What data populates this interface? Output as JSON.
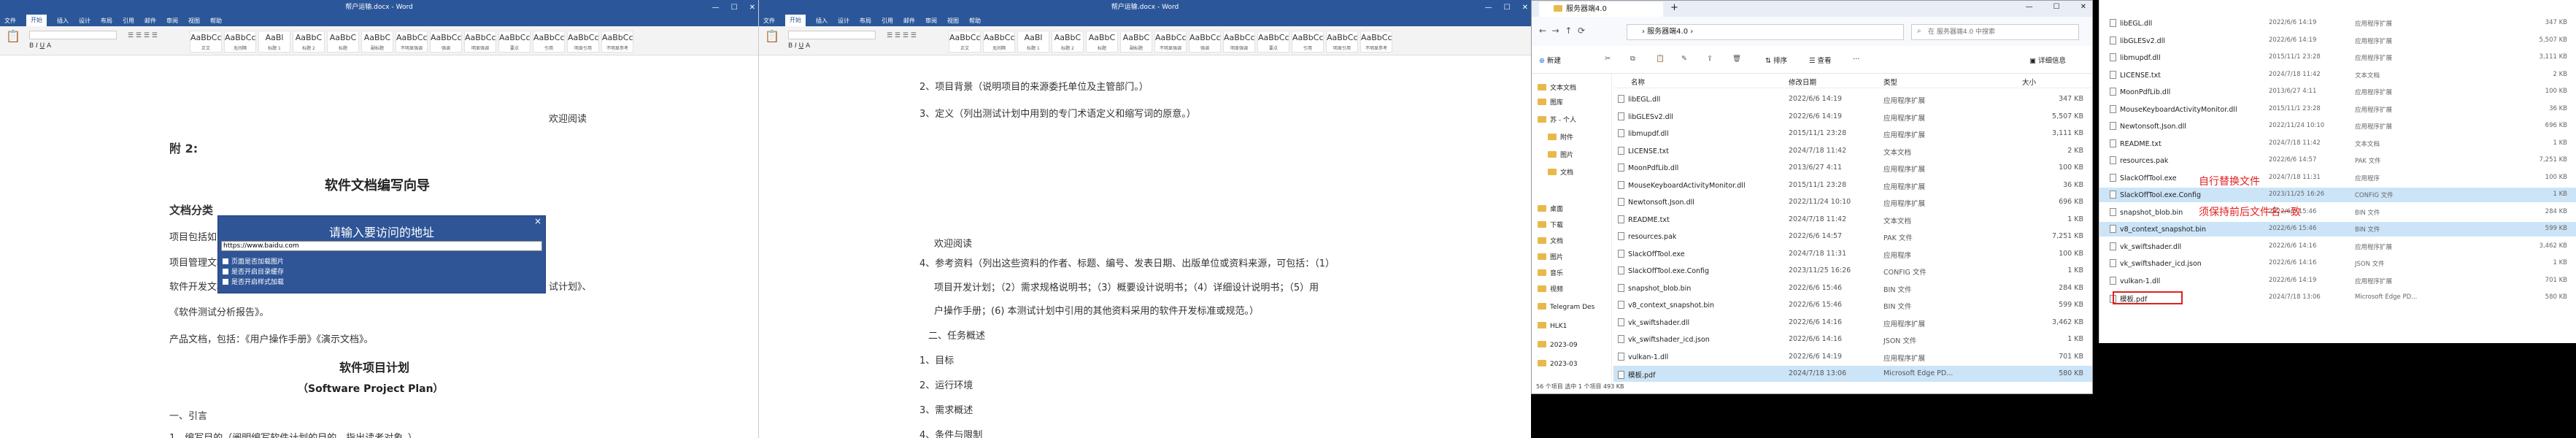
{
  "word_window_1": {
    "title": "帮户运输.docx - Word",
    "tabs": [
      "文件",
      "开始",
      "插入",
      "设计",
      "布局",
      "引用",
      "邮件",
      "审阅",
      "视图",
      "帮助"
    ],
    "active_tab": "开始",
    "styles": [
      {
        "sample": "AaBbCcDd",
        "name": "正文"
      },
      {
        "sample": "AaBbCcDd",
        "name": "无间隔"
      },
      {
        "sample": "AaBl",
        "name": "标题 1"
      },
      {
        "sample": "AaBbC",
        "name": "标题 2"
      },
      {
        "sample": "AaBbC",
        "name": "标题"
      },
      {
        "sample": "AaBbC",
        "name": "副标题"
      },
      {
        "sample": "AaBbCcDd",
        "name": "不明显强调"
      },
      {
        "sample": "AaBbCcDd",
        "name": "强调"
      },
      {
        "sample": "AaBbCcDd",
        "name": "明显强调"
      },
      {
        "sample": "AaBbCcDd",
        "name": "要点"
      },
      {
        "sample": "AaBbCcDd",
        "name": "引用"
      },
      {
        "sample": "AaBbCcDd",
        "name": "明显引用"
      },
      {
        "sample": "AaBbCcDd",
        "name": "不明显参考"
      }
    ],
    "doc": {
      "welcome": "欢迎阅读",
      "appendix": "附 2:",
      "heading1": "软件文档编写向导",
      "section": "文档分类",
      "p1": "项目包括如下几类文档：",
      "p2": "项目管理文档，包括：《软件需求说明书》、《数据库设计》",
      "p3": "软件开发文档，包括：《可行性分析报告》、《项目开发计划》、《软件需求规格说明书》、《测试计划》、",
      "p3b": "试计划》、",
      "p4": "《软件测试分析报告》。",
      "p5": "产品文档，包括：《用户操作手册》《演示文档》。",
      "heading2": "软件项目计划",
      "heading2_en": "（Software Project Plan）",
      "intro": "一、引言",
      "item1": "1、编写目的（阐明编写软件计划的目的，指出读者对象。）"
    },
    "popup": {
      "title": "请输入要访问的地址",
      "url": "https://www.baidu.com",
      "options": [
        "页面是否加载图片",
        "是否开启目录缓存",
        "是否开启样式加载"
      ],
      "close": "×"
    }
  },
  "word_window_2": {
    "title": "帮户运输.docx - Word",
    "tabs": [
      "文件",
      "开始",
      "插入",
      "设计",
      "布局",
      "引用",
      "邮件",
      "审阅",
      "视图",
      "帮助"
    ],
    "active_tab": "开始",
    "styles": [
      {
        "sample": "AaBbCcDd",
        "name": "正文"
      },
      {
        "sample": "AaBbCcDd",
        "name": "无间隔"
      },
      {
        "sample": "AaBl",
        "name": "标题 1"
      },
      {
        "sample": "AaBbC",
        "name": "标题 2"
      },
      {
        "sample": "AaBbC",
        "name": "标题"
      },
      {
        "sample": "AaBbC",
        "name": "副标题"
      },
      {
        "sample": "AaBbCcDd",
        "name": "不明显强调"
      },
      {
        "sample": "AaBbCcDd",
        "name": "强调"
      },
      {
        "sample": "AaBbCcDd",
        "name": "明显强调"
      },
      {
        "sample": "AaBbCcDd",
        "name": "要点"
      },
      {
        "sample": "AaBbCcDd",
        "name": "引用"
      },
      {
        "sample": "AaBbCcDd",
        "name": "明显引用"
      },
      {
        "sample": "AaBbCcDd",
        "name": "不明显参考"
      }
    ],
    "doc": {
      "l1": "2、项目背景（说明项目的来源委托单位及主管部门。）",
      "l2": "3、定义（列出测试计划中用到的专门术语定义和缩写词的原意。）",
      "welcome": "欢迎阅读",
      "l3": "4、参考资料（列出这些资料的作者、标题、编号、发表日期、出版单位或资料来源，可包括：（1）",
      "l4": "项目开发计划；（2）需求规格说明书；（3）概要设计说明书；（4）详细设计说明书；（5）用",
      "l5": "户操作手册；(6) 本测试计划中引用的其他资料采用的软件开发标准或规范。）",
      "l6": "二、任务概述",
      "l7": "1、目标",
      "l8": "2、运行环境",
      "l9": "3、需求概述",
      "l10": "4、条件与限制"
    }
  },
  "explorer": {
    "title": "服务器端4.0",
    "tab": "服务器端4.0",
    "plus": "+",
    "breadcrumb": [
      "服务器端4.0"
    ],
    "search_placeholder": "在 服务器端4.0 中搜索",
    "toolbar": {
      "new": "新建",
      "sort": "排序",
      "view": "查看",
      "details": "详细信息"
    },
    "columns": {
      "name": "名称",
      "date": "修改日期",
      "type": "类型",
      "size": "大小"
    },
    "nav": [
      {
        "label": "文本文档",
        "indent": 0
      },
      {
        "label": "图库",
        "indent": 0
      },
      {
        "label": "苏 - 个人",
        "indent": 0
      },
      {
        "label": "附件",
        "indent": 1
      },
      {
        "label": "图片",
        "indent": 1
      },
      {
        "label": "文档",
        "indent": 1
      },
      {
        "label": "桌面",
        "indent": 0
      },
      {
        "label": "下载",
        "indent": 0
      },
      {
        "label": "文档",
        "indent": 0
      },
      {
        "label": "图片",
        "indent": 0
      },
      {
        "label": "音乐",
        "indent": 0
      },
      {
        "label": "视频",
        "indent": 0
      },
      {
        "label": "Telegram Des",
        "indent": 0
      },
      {
        "label": "HLK1",
        "indent": 0
      },
      {
        "label": "2023-09",
        "indent": 0
      },
      {
        "label": "2023-03",
        "indent": 0
      }
    ],
    "files": [
      {
        "name": "libEGL.dll",
        "date": "2022/6/6 14:19",
        "type": "应用程序扩展",
        "size": "347 KB"
      },
      {
        "name": "libGLESv2.dll",
        "date": "2022/6/6 14:19",
        "type": "应用程序扩展",
        "size": "5,507 KB"
      },
      {
        "name": "libmupdf.dll",
        "date": "2015/11/1 23:28",
        "type": "应用程序扩展",
        "size": "3,111 KB"
      },
      {
        "name": "LICENSE.txt",
        "date": "2024/7/18 11:42",
        "type": "文本文档",
        "size": "2 KB"
      },
      {
        "name": "MoonPdfLib.dll",
        "date": "2013/6/27 4:11",
        "type": "应用程序扩展",
        "size": "100 KB"
      },
      {
        "name": "MouseKeyboardActivityMonitor.dll",
        "date": "2015/11/1 23:28",
        "type": "应用程序扩展",
        "size": "36 KB"
      },
      {
        "name": "Newtonsoft.Json.dll",
        "date": "2022/11/24 10:10",
        "type": "应用程序扩展",
        "size": "696 KB"
      },
      {
        "name": "README.txt",
        "date": "2024/7/18 11:42",
        "type": "文本文档",
        "size": "1 KB"
      },
      {
        "name": "resources.pak",
        "date": "2022/6/6 14:57",
        "type": "PAK 文件",
        "size": "7,251 KB"
      },
      {
        "name": "SlackOffTool.exe",
        "date": "2024/7/18 11:31",
        "type": "应用程序",
        "size": "100 KB"
      },
      {
        "name": "SlackOffTool.exe.Config",
        "date": "2023/11/25 16:26",
        "type": "CONFIG 文件",
        "size": "1 KB"
      },
      {
        "name": "snapshot_blob.bin",
        "date": "2022/6/6 15:46",
        "type": "BIN 文件",
        "size": "284 KB"
      },
      {
        "name": "v8_context_snapshot.bin",
        "date": "2022/6/6 15:46",
        "type": "BIN 文件",
        "size": "599 KB"
      },
      {
        "name": "vk_swiftshader.dll",
        "date": "2022/6/6 14:16",
        "type": "应用程序扩展",
        "size": "3,462 KB"
      },
      {
        "name": "vk_swiftshader_icd.json",
        "date": "2022/6/6 14:16",
        "type": "JSON 文件",
        "size": "1 KB"
      },
      {
        "name": "vulkan-1.dll",
        "date": "2022/6/6 14:19",
        "type": "应用程序扩展",
        "size": "701 KB"
      },
      {
        "name": "模板.pdf",
        "date": "2024/7/18 13:06",
        "type": "Microsoft Edge PD...",
        "size": "580 KB"
      }
    ],
    "status": "56 个项目   选中 1 个项目 493 KB"
  },
  "zoom_panel": {
    "files": [
      {
        "name": "libEGL.dll",
        "date": "2022/6/6 14:19",
        "type": "应用程序扩展",
        "size": "347 KB"
      },
      {
        "name": "libGLESv2.dll",
        "date": "2022/6/6 14:19",
        "type": "应用程序扩展",
        "size": "5,507 KB"
      },
      {
        "name": "libmupdf.dll",
        "date": "2015/11/1 23:28",
        "type": "应用程序扩展",
        "size": "3,111 KB"
      },
      {
        "name": "LICENSE.txt",
        "date": "2024/7/18 11:42",
        "type": "文本文档",
        "size": "2 KB"
      },
      {
        "name": "MoonPdfLib.dll",
        "date": "2013/6/27 4:11",
        "type": "应用程序扩展",
        "size": "100 KB"
      },
      {
        "name": "MouseKeyboardActivityMonitor.dll",
        "date": "2015/11/1 23:28",
        "type": "应用程序扩展",
        "size": "36 KB"
      },
      {
        "name": "Newtonsoft.Json.dll",
        "date": "2022/11/24 10:10",
        "type": "应用程序扩展",
        "size": "696 KB"
      },
      {
        "name": "README.txt",
        "date": "2024/7/18 11:42",
        "type": "文本文档",
        "size": "1 KB"
      },
      {
        "name": "resources.pak",
        "date": "2022/6/6 14:57",
        "type": "PAK 文件",
        "size": "7,251 KB"
      },
      {
        "name": "SlackOffTool.exe",
        "date": "2024/7/18 11:31",
        "type": "应用程序",
        "size": "100 KB"
      },
      {
        "name": "SlackOffTool.exe.Config",
        "date": "2023/11/25 16:26",
        "type": "CONFIG 文件",
        "size": "1 KB"
      },
      {
        "name": "snapshot_blob.bin",
        "date": "2022/6/6 15:46",
        "type": "BIN 文件",
        "size": "284 KB"
      },
      {
        "name": "v8_context_snapshot.bin",
        "date": "2022/6/6 15:46",
        "type": "BIN 文件",
        "size": "599 KB"
      },
      {
        "name": "vk_swiftshader.dll",
        "date": "2022/6/6 14:16",
        "type": "应用程序扩展",
        "size": "3,462 KB"
      },
      {
        "name": "vk_swiftshader_icd.json",
        "date": "2022/6/6 14:16",
        "type": "JSON 文件",
        "size": "1 KB"
      },
      {
        "name": "vulkan-1.dll",
        "date": "2022/6/6 14:19",
        "type": "应用程序扩展",
        "size": "701 KB"
      },
      {
        "name": "模板.pdf",
        "date": "2024/7/18 13:06",
        "type": "Microsoft Edge PD...",
        "size": "580 KB"
      }
    ],
    "annotation1": "自行替换文件",
    "annotation2": "须保持前后文件名一致"
  },
  "colors": {
    "word_blue": "#2b579a",
    "selection": "#cce4f7",
    "annotation_red": "#e02020",
    "popup_blue": "#2f5597"
  }
}
